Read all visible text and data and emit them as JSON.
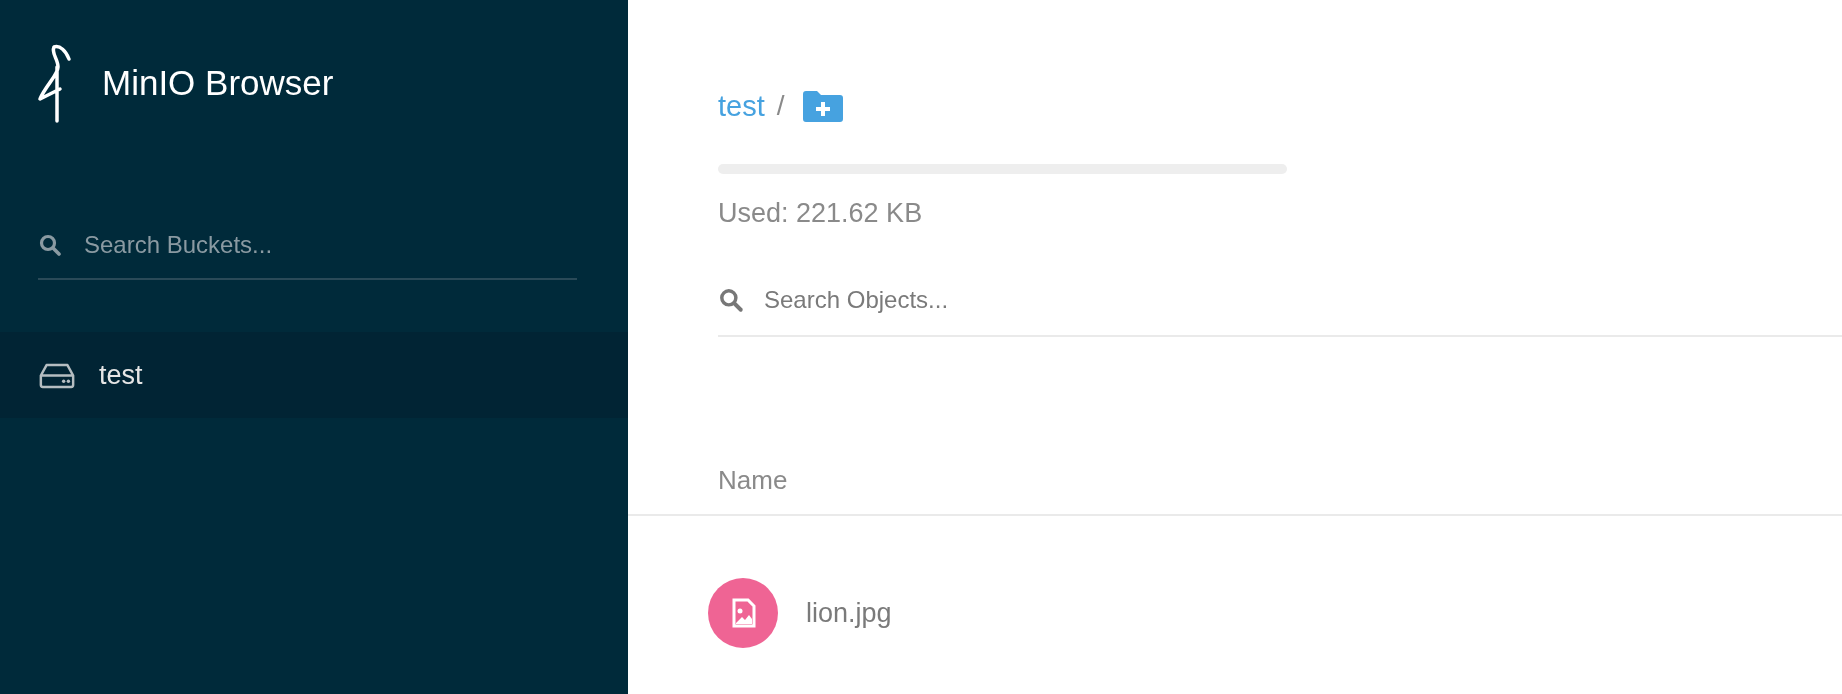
{
  "sidebar": {
    "app_title": "MinIO Browser",
    "search": {
      "placeholder": "Search Buckets..."
    },
    "buckets": [
      {
        "name": "test",
        "selected": true
      }
    ]
  },
  "main": {
    "breadcrumb": [
      "test"
    ],
    "separator": "/",
    "usage": {
      "level": 0,
      "label": "Used: 221.62 KB"
    },
    "search": {
      "placeholder": "Search Objects..."
    },
    "table": {
      "columns": [
        "Name"
      ],
      "rows": [
        {
          "kind": "image",
          "name": "lion.jpg"
        }
      ]
    }
  }
}
